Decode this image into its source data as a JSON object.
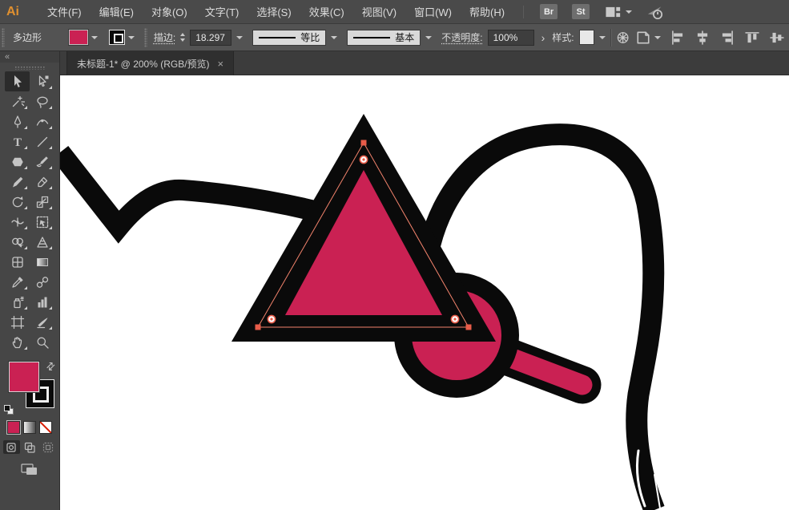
{
  "colors": {
    "pink": "#CA2153",
    "ink": "#0A0A0A",
    "sel": "#F2836C",
    "anchor": "#E85C49",
    "icon": "#C4C4C4",
    "bgMenubar": "#4A4A4A",
    "bgControlbar": "#535353",
    "bgPanel": "#464646",
    "bgTabstrip": "#3C3C3C",
    "bgTab": "#2F2F2F",
    "bgCanvas": "#FFFFFF",
    "text": "#DCDCDC",
    "field": "#3E3E3E",
    "dropdown": "#D9D9D9",
    "logo": "#E0902F"
  },
  "menu_bar": {
    "logo_text": "Ai",
    "menus": [
      "文件(F)",
      "编辑(E)",
      "对象(O)",
      "文字(T)",
      "选择(S)",
      "效果(C)",
      "视图(V)",
      "窗口(W)",
      "帮助(H)"
    ],
    "bridge_button": "Br",
    "stock_button": "St"
  },
  "control_bar": {
    "context_label": "多边形",
    "stroke_label": "描边:",
    "stroke_value": "18.297",
    "width_profile": "等比",
    "brush_definition": "基本",
    "opacity_label": "不透明度:",
    "opacity_value": "100%",
    "expand_arrow": "›",
    "style_label": "样式:"
  },
  "document_tab": {
    "title": "未标题-1* @ 200% (RGB/预览)",
    "close": "×"
  },
  "toolbar": {
    "collapse_glyph": "«",
    "swap_glyph": "⇄",
    "tools": [
      {
        "name": "selection-tool",
        "active": true,
        "flyout": false
      },
      {
        "name": "direct-selection-tool",
        "flyout": true
      },
      {
        "name": "magic-wand-tool",
        "flyout": true
      },
      {
        "name": "lasso-tool",
        "flyout": true
      },
      {
        "name": "pen-tool",
        "flyout": true
      },
      {
        "name": "curvature-tool",
        "flyout": true
      },
      {
        "name": "type-tool",
        "flyout": true
      },
      {
        "name": "line-segment-tool",
        "flyout": true
      },
      {
        "name": "polygon-tool",
        "flyout": true
      },
      {
        "name": "paintbrush-tool",
        "flyout": true
      },
      {
        "name": "shaper-tool",
        "flyout": true
      },
      {
        "name": "eraser-tool",
        "flyout": true
      },
      {
        "name": "rotate-tool",
        "flyout": true
      },
      {
        "name": "scale-tool",
        "flyout": true
      },
      {
        "name": "width-tool",
        "flyout": true
      },
      {
        "name": "free-transform-tool",
        "flyout": true
      },
      {
        "name": "shape-builder-tool",
        "flyout": true
      },
      {
        "name": "perspective-grid-tool",
        "flyout": true
      },
      {
        "name": "mesh-tool",
        "flyout": false
      },
      {
        "name": "gradient-tool",
        "flyout": false
      },
      {
        "name": "eyedropper-tool",
        "flyout": true
      },
      {
        "name": "blend-tool",
        "flyout": false
      },
      {
        "name": "symbol-sprayer-tool",
        "flyout": true
      },
      {
        "name": "column-graph-tool",
        "flyout": true
      },
      {
        "name": "artboard-tool",
        "flyout": false
      },
      {
        "name": "slice-tool",
        "flyout": true
      },
      {
        "name": "hand-tool",
        "flyout": true
      },
      {
        "name": "zoom-tool",
        "flyout": false
      }
    ]
  }
}
